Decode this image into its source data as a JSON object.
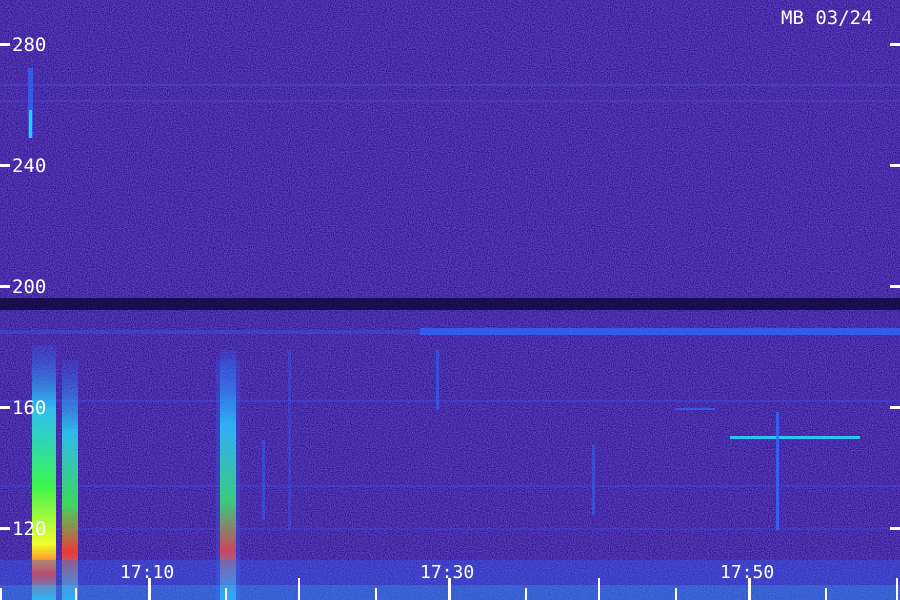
{
  "station_label": "MB 03/24",
  "y_axis": {
    "tick_labels": [
      "280",
      "240",
      "200",
      "160",
      "120"
    ]
  },
  "x_axis": {
    "time_labels": [
      "17:10",
      "17:30",
      "17:50"
    ]
  },
  "colors": {
    "background": "#2a0f8a",
    "noise_low": "#1a0a5a",
    "noise_high": "#3a22c8",
    "signal_blue": "#2f6bff",
    "signal_cyan": "#27e3ff",
    "signal_green": "#3cff4a",
    "signal_yellow": "#f2ff2a",
    "signal_red": "#ff3a2a",
    "tick": "#ffffff",
    "text": "#ffffff"
  }
}
